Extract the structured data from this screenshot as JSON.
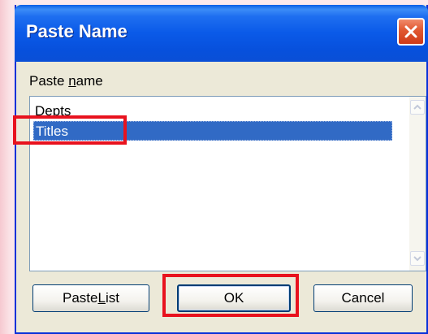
{
  "dialog": {
    "title": "Paste Name",
    "close_icon": "close-icon",
    "list_label_prefix": "Paste ",
    "list_label_accel": "n",
    "list_label_suffix": "ame",
    "items": [
      "Depts",
      "Titles"
    ],
    "selected_index": 1,
    "buttons": {
      "paste_list_prefix": "Paste ",
      "paste_list_accel": "L",
      "paste_list_suffix": "ist",
      "ok": "OK",
      "cancel": "Cancel"
    }
  },
  "colors": {
    "selection": "#316ac5",
    "annotation": "#e8121e",
    "titlebar": "#0a5ae8"
  }
}
